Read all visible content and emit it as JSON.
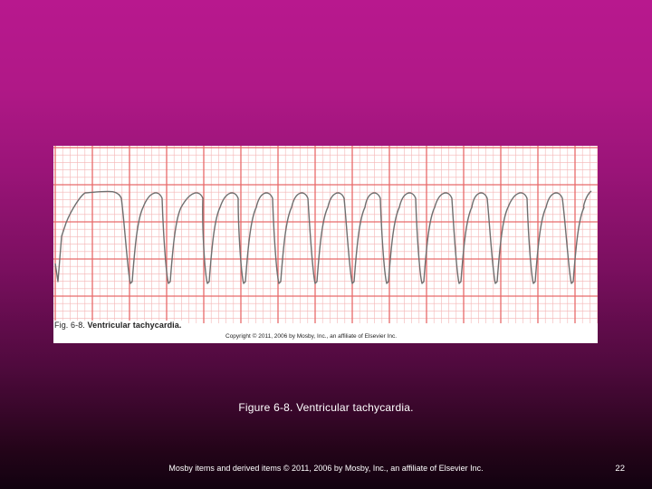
{
  "figure": {
    "label_number": "Fig. 6-8.",
    "label_title": "Ventricular tachycardia.",
    "copyright": "Copyright © 2011, 2006 by Mosby, Inc., an affiliate of Elsevier Inc."
  },
  "caption": "Figure 6-8. Ventricular tachycardia.",
  "footer": {
    "copyright": "Mosby items and derived items © 2011, 2006 by Mosby, Inc., an affiliate of Elsevier Inc.",
    "page_number": "22"
  },
  "colors": {
    "grid_major": "#e86a6a",
    "grid_minor": "#f4b5b5",
    "trace": "#6f6f6f"
  }
}
